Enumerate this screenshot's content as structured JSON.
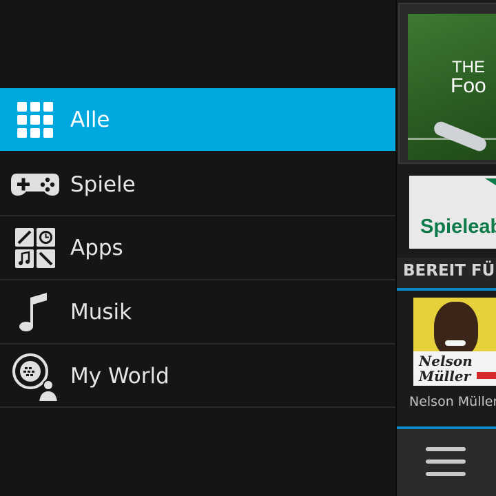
{
  "menu": {
    "items": [
      {
        "label": "Alle",
        "icon": "grid-icon",
        "active": true
      },
      {
        "label": "Spiele",
        "icon": "gamepad-icon",
        "active": false
      },
      {
        "label": "Apps",
        "icon": "apps-icon",
        "active": false
      },
      {
        "label": "Musik",
        "icon": "music-note-icon",
        "active": false
      },
      {
        "label": "My World",
        "icon": "my-world-icon",
        "active": false
      }
    ]
  },
  "content": {
    "featured_tile": {
      "line1": "THE",
      "line2": "Foo"
    },
    "promo_tile": {
      "text": "Spieleab"
    },
    "section_header": "BEREIT FÜR",
    "album": {
      "name_line1": "Nelson",
      "name_line2": "Müller"
    },
    "album_caption": "Nelson Müller"
  },
  "colors": {
    "accent": "#00a8e0",
    "background": "#151515",
    "separator_blue": "#0a89c4"
  }
}
